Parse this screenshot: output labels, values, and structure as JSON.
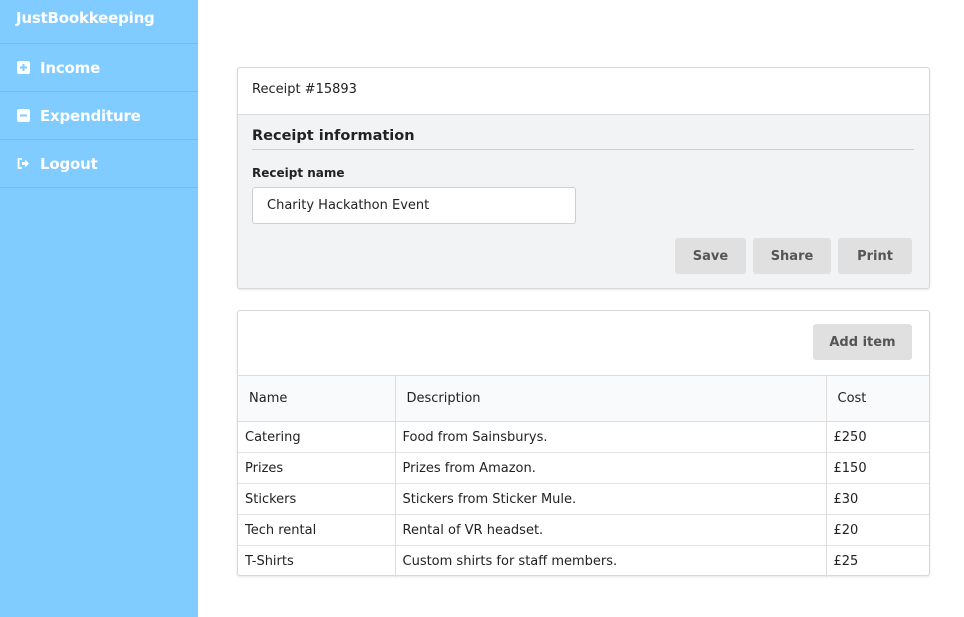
{
  "app": {
    "brand": "JustBookkeeping"
  },
  "sidebar": {
    "items": [
      {
        "label": "Income",
        "icon": "plus-square-icon"
      },
      {
        "label": "Expenditure",
        "icon": "minus-square-icon"
      },
      {
        "label": "Logout",
        "icon": "sign-out-icon"
      }
    ]
  },
  "receipt": {
    "header": "Receipt #15893",
    "section_title": "Receipt information",
    "name_label": "Receipt name",
    "name_value": "Charity Hackathon Event",
    "save_label": "Save",
    "share_label": "Share",
    "print_label": "Print"
  },
  "items": {
    "add_label": "Add item",
    "columns": [
      "Name",
      "Description",
      "Cost"
    ],
    "rows": [
      [
        "Catering",
        "Food from Sainsburys.",
        "£250"
      ],
      [
        "Prizes",
        "Prizes from Amazon.",
        "£150"
      ],
      [
        "Stickers",
        "Stickers from Sticker Mule.",
        "£30"
      ],
      [
        "Tech rental",
        "Rental of VR headset.",
        "£20"
      ],
      [
        "T-Shirts",
        "Custom shirts for staff members.",
        "£25"
      ]
    ]
  },
  "colors": {
    "sidebar": "#80cbff",
    "button": "#e0e0e0",
    "panel": "#f2f3f5"
  }
}
